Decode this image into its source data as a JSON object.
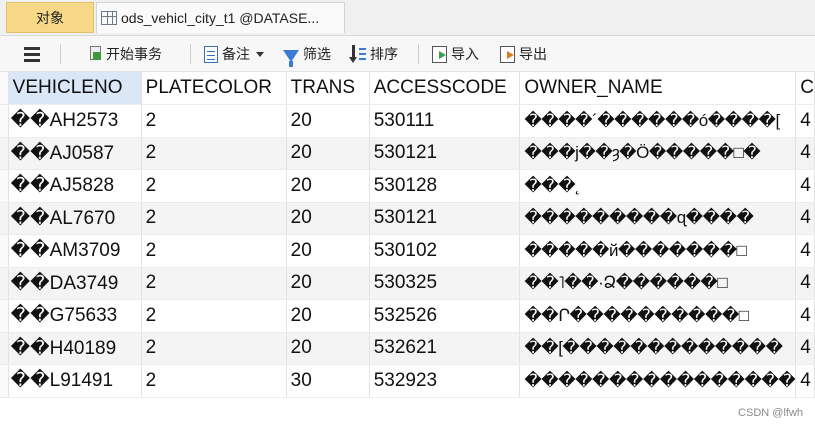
{
  "tabs": [
    {
      "label": "对象"
    },
    {
      "label": "ods_vehicl_city_t1 @DATASE..."
    }
  ],
  "toolbar": {
    "begin_transaction": "开始事务",
    "note": "备注",
    "filter": "筛选",
    "sort": "排序",
    "import": "导入",
    "export": "导出"
  },
  "grid": {
    "columns": [
      "VEHICLENO",
      "PLATECOLOR",
      "TRANS",
      "ACCESSCODE",
      "OWNER_NAME",
      "C"
    ],
    "rows": [
      {
        "vehicleno": "��AH2573",
        "platecolor": "2",
        "trans": "20",
        "accesscode": "530111",
        "owner_name": "����´������ó����[",
        "extra": "4"
      },
      {
        "vehicleno": "��AJ0587",
        "platecolor": "2",
        "trans": "20",
        "accesscode": "530121",
        "owner_name": "���j��ȝ�Ö�����□�",
        "extra": "4"
      },
      {
        "vehicleno": "��AJ5828",
        "platecolor": "2",
        "trans": "20",
        "accesscode": "530128",
        "owner_name": "���˛",
        "extra": "4"
      },
      {
        "vehicleno": "��AL7670",
        "platecolor": "2",
        "trans": "20",
        "accesscode": "530121",
        "owner_name": "���������ɋ����",
        "extra": "4"
      },
      {
        "vehicleno": "��AM3709",
        "platecolor": "2",
        "trans": "20",
        "accesscode": "530102",
        "owner_name": "�����й�������□",
        "extra": "4"
      },
      {
        "vehicleno": "��DA3749",
        "platecolor": "2",
        "trans": "20",
        "accesscode": "530325",
        "owner_name": "��˥��·Ձ������□",
        "extra": "4"
      },
      {
        "vehicleno": "��G75633",
        "platecolor": "2",
        "trans": "20",
        "accesscode": "532526",
        "owner_name": "��Ր����������□",
        "extra": "4"
      },
      {
        "vehicleno": "��H40189",
        "platecolor": "2",
        "trans": "20",
        "accesscode": "532621",
        "owner_name": "��[�������������",
        "extra": "4"
      },
      {
        "vehicleno": "��L91491",
        "platecolor": "2",
        "trans": "30",
        "accesscode": "532923",
        "owner_name": "����������������",
        "extra": "4"
      }
    ]
  },
  "watermark": "CSDN @lfwh"
}
